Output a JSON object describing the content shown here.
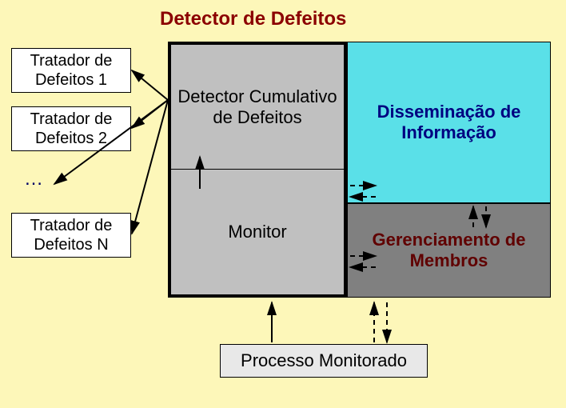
{
  "title": "Detector de Defeitos",
  "handlers": {
    "h1": "Tratador de\nDefeitos 1",
    "h2": "Tratador de\nDefeitos 2",
    "ellipsis": "…",
    "hN": "Tratador de\nDefeitos N"
  },
  "detector": {
    "cumulative": "Detector Cumulativo de Defeitos",
    "monitor": "Monitor"
  },
  "dissemination": "Disseminação de Informação",
  "membership": "Gerenciamento de Membros",
  "process": "Processo Monitorado"
}
